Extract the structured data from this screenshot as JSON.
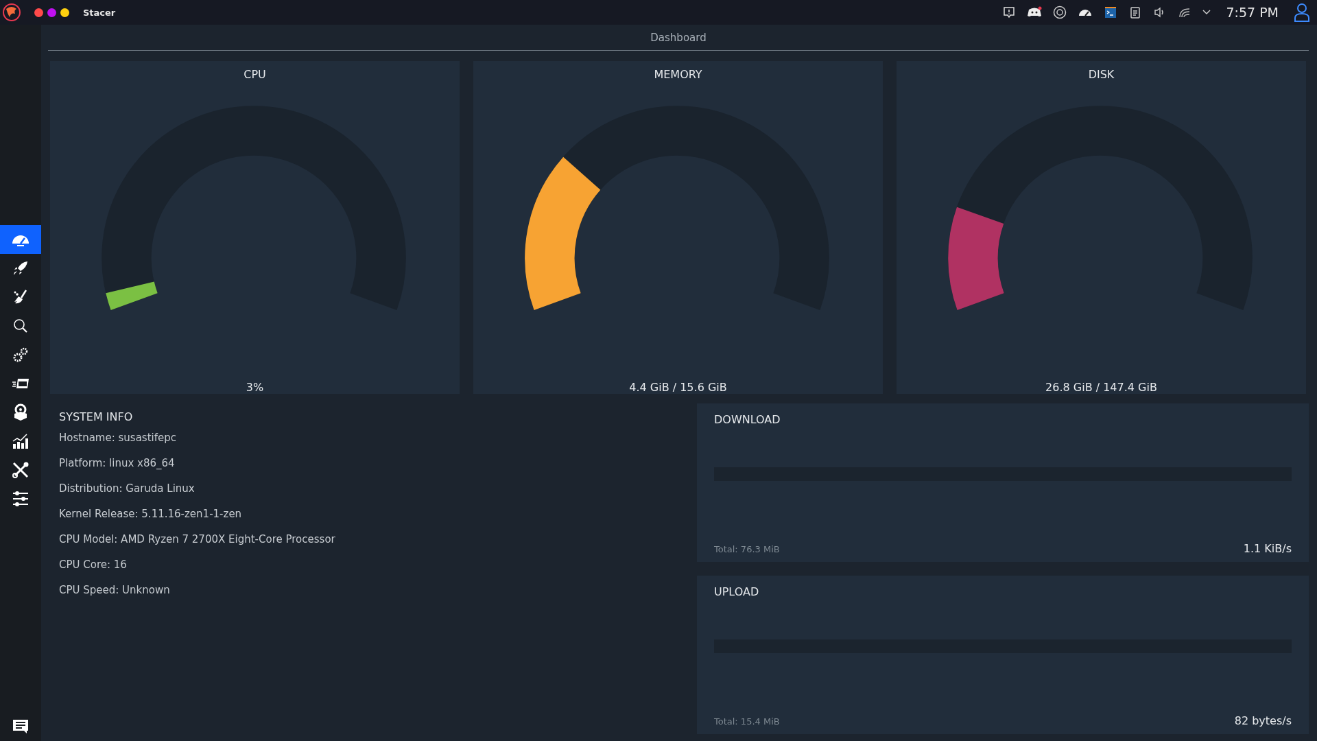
{
  "window": {
    "title": "Stacer"
  },
  "topbar": {
    "clock": "7:57 PM"
  },
  "sidebar": {
    "items": [
      {
        "kind": "dashboard",
        "selected": true
      },
      {
        "kind": "startup",
        "selected": false
      },
      {
        "kind": "cleaner",
        "selected": false
      },
      {
        "kind": "search",
        "selected": false
      },
      {
        "kind": "services",
        "selected": false
      },
      {
        "kind": "processes",
        "selected": false
      },
      {
        "kind": "uninstaller",
        "selected": false
      },
      {
        "kind": "resources",
        "selected": false
      },
      {
        "kind": "tools",
        "selected": false
      },
      {
        "kind": "settings",
        "selected": false
      }
    ]
  },
  "header": {
    "title": "Dashboard"
  },
  "gauges": [
    {
      "title": "CPU",
      "level": 0.03,
      "reading": "3%",
      "color": "#7bc043"
    },
    {
      "title": "MEMORY",
      "level": 0.28,
      "reading": "4.4 GiB / 15.6 GiB",
      "color": "#f7a333"
    },
    {
      "title": "DISK",
      "level": 0.18,
      "reading": "26.8 GiB / 147.4 GiB",
      "color": "#b03262"
    }
  ],
  "system_info": {
    "title": "SYSTEM INFO",
    "lines": [
      "Hostname: susastifepc",
      "Platform: linux x86_64",
      "Distribution: Garuda Linux",
      "Kernel Release: 5.11.16-zen1-1-zen",
      "CPU Model:  AMD Ryzen 7 2700X Eight-Core Processor",
      "CPU Core: 16",
      "CPU Speed: Unknown"
    ]
  },
  "network": [
    {
      "title": "DOWNLOAD",
      "total": "Total: 76.3 MiB",
      "speed": "1.1 KiB/s"
    },
    {
      "title": "UPLOAD",
      "total": "Total: 15.4 MiB",
      "speed": "82 bytes/s"
    }
  ]
}
